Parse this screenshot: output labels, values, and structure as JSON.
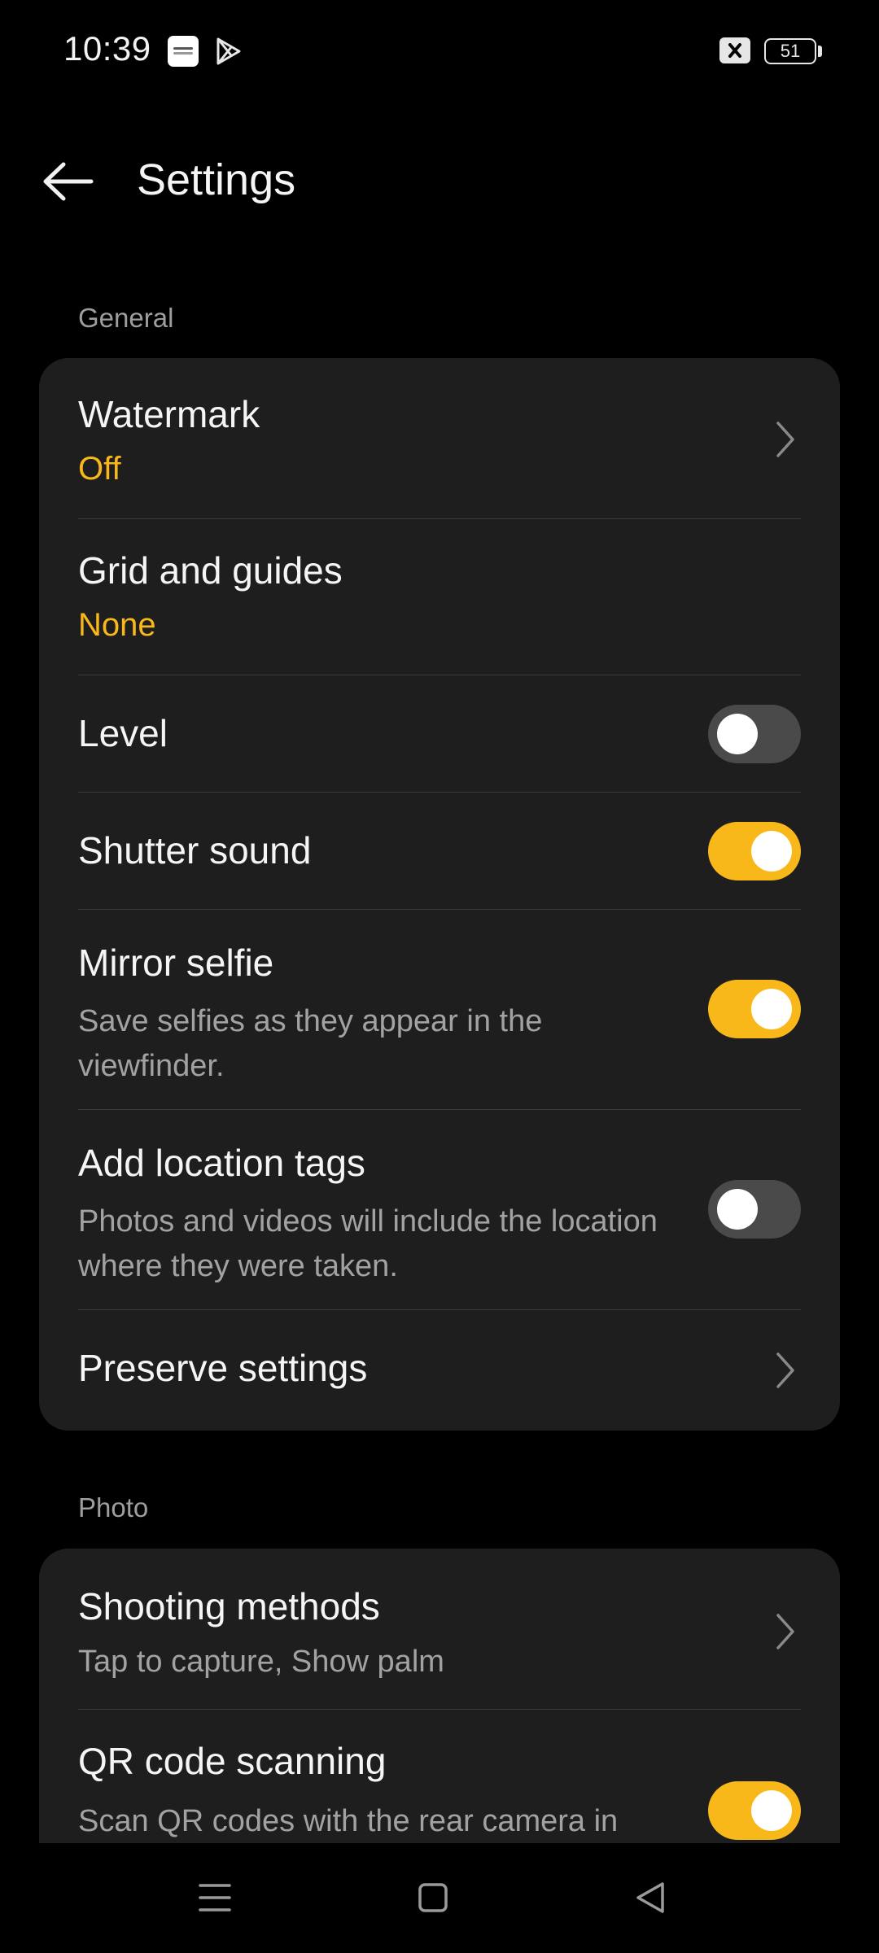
{
  "status_bar": {
    "time": "10:39",
    "battery_level": "51",
    "icons": [
      "app-notification-icon",
      "play-store-icon",
      "no-sim-icon",
      "battery-icon"
    ]
  },
  "header": {
    "title": "Settings",
    "back_icon": "arrow-left-icon"
  },
  "sections": {
    "general": {
      "label": "General",
      "watermark": {
        "title": "Watermark",
        "value": "Off"
      },
      "grid_and_guides": {
        "title": "Grid and guides",
        "value": "None"
      },
      "level": {
        "title": "Level",
        "enabled": false
      },
      "shutter_sound": {
        "title": "Shutter sound",
        "enabled": true
      },
      "mirror_selfie": {
        "title": "Mirror selfie",
        "description": "Save selfies as they appear in the viewfinder.",
        "enabled": true
      },
      "add_location_tags": {
        "title": "Add location tags",
        "description": "Photos and videos will include the location where they were taken.",
        "enabled": false
      },
      "preserve_settings": {
        "title": "Preserve settings"
      }
    },
    "photo": {
      "label": "Photo",
      "shooting_methods": {
        "title": "Shooting methods",
        "description": "Tap to capture, Show palm"
      },
      "qr_code_scanning": {
        "title": "QR code scanning",
        "description": "Scan QR codes with the rear camera in",
        "enabled": true
      }
    }
  },
  "colors": {
    "accent": "#f9b81a",
    "card_background": "#1e1e1e",
    "toggle_off": "#4a4a4a"
  },
  "nav_bar": {
    "icons": [
      "menu-icon",
      "home-icon",
      "back-icon"
    ]
  }
}
